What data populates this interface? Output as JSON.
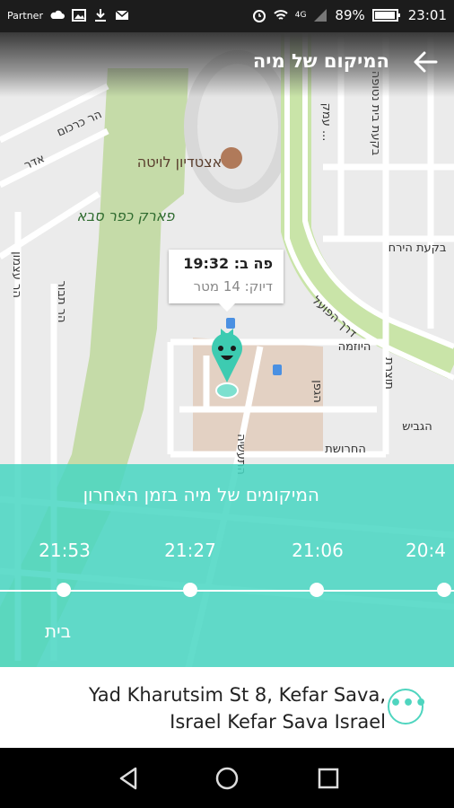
{
  "statusbar": {
    "carrier": "Partner",
    "network": "4G",
    "battery": "89%",
    "time": "23:01"
  },
  "header": {
    "title": "המיקום של מיה"
  },
  "map": {
    "labels": {
      "stadium": "אצטדיון לויטה",
      "park": "פארק כפר סבא",
      "street1": "הר כרכום",
      "street2": "אדר",
      "street3": "דרך הפועל",
      "street4": "בקעת הירח",
      "street5": "היוזמה",
      "street6": "הגביש",
      "street7": "החרושת",
      "street8": "הגפן",
      "street9": "התעשיה",
      "street10": "תוצרת",
      "street11": "הר תבור",
      "street12": "הר עצמון",
      "street13": "בקעת בית נטופה",
      "street14": "עמק ..."
    },
    "callout": {
      "line1": "פה ב: 19:32",
      "line2": "דיוק: 14 מטר"
    }
  },
  "recent_panel": {
    "heading": "המיקומים של מיה בזמן האחרון",
    "times": [
      "21:53",
      "21:27",
      "21:06",
      "20:4"
    ],
    "home_label": "בית"
  },
  "address": {
    "line1": "Yad Kharutsim St 8, Kefar Sava,",
    "line2": "Israel Kefar Sava Israel"
  },
  "colors": {
    "accent": "#48d6c2",
    "park": "#c5dba8",
    "highway": "#c9e4a8"
  }
}
